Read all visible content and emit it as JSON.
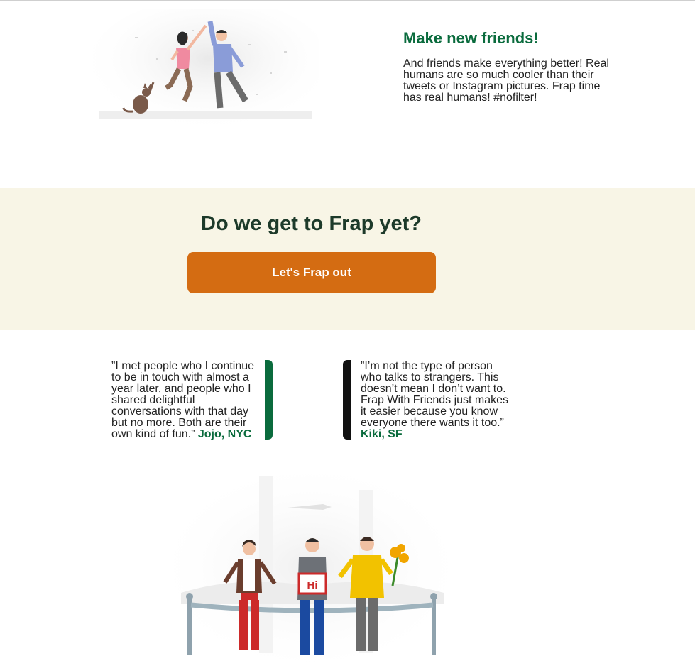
{
  "friends_section": {
    "title": "Make new friends!",
    "body": "And friends make everything better! Real humans are so much cooler than their tweets or Instagram pictures. Frap time has real humans! #nofilter!"
  },
  "cta": {
    "heading": "Do we get to Frap yet?",
    "button_label": "Let's Frap out"
  },
  "testimonials": [
    {
      "quote": "”I met people who I continue to be in touch with almost a year later, and people who I shared delightful conversations with that day but no more. Both are their own kind of fun.”",
      "author": "Jojo, NYC"
    },
    {
      "quote": "”I’m not the type of person who talks to strangers. This doesn’t mean I don’t want to. Frap With Friends just makes it easier because you know everyone there wants it too.”",
      "author": "Kiki, SF"
    }
  ],
  "illustration_sign": "Hi",
  "colors": {
    "brand_green": "#0a6b3d",
    "cta_orange": "#d46c12",
    "band_cream": "#f8f5e6"
  }
}
